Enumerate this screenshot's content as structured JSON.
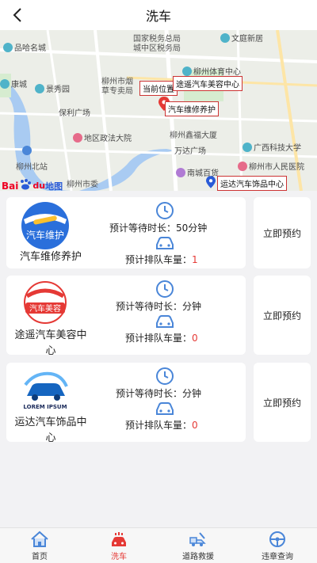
{
  "header": {
    "title": "洗车"
  },
  "map": {
    "labels": {
      "tax_bureau_1": "国家税务总局",
      "tax_bureau_2": "城中区税务局",
      "wenting": "文庭新居",
      "pinming": "品哈名城",
      "gym": "柳州体育中心",
      "kangcheng": "康城",
      "jingxiu": "景秀园",
      "tobacco_1": "柳州市烟",
      "tobacco_2": "草专卖局",
      "baoli": "保利广场",
      "zhengfa": "地区政法大院",
      "xiangfu": "柳州鑫福大厦",
      "wanda": "万达广场",
      "guangxi_tech": "广西科技大学",
      "north_station": "柳州北站",
      "hospital": "柳州市人民医院",
      "nancheng": "南城百货",
      "city_commission": "柳州市委"
    },
    "callouts": {
      "current": "当前位置",
      "shop1": "途遥汽车美容中心",
      "shop2": "汽车维修养护",
      "shop3": "运达汽车饰品中心"
    },
    "brand": {
      "bai": "Bai",
      "du": "du",
      "map": "地图"
    }
  },
  "shops": [
    {
      "name": "汽车维修养护",
      "logo_text": "汽车维护",
      "wait_label": "预计等待时长：",
      "wait_value": "50分钟",
      "queue_label": "预计排队车量：",
      "queue_value": "1",
      "book_label": "立即预约"
    },
    {
      "name": "途遥汽车美容中心",
      "logo_text": "汽车美容",
      "wait_label": "预计等待时长：",
      "wait_value": "分钟",
      "queue_label": "预计排队车量：",
      "queue_value": "0",
      "book_label": "立即预约"
    },
    {
      "name": "运达汽车饰品中心",
      "logo_text": "LOREM IPSUM",
      "wait_label": "预计等待时长：",
      "wait_value": "分钟",
      "queue_label": "预计排队车量：",
      "queue_value": "0",
      "book_label": "立即预约"
    }
  ],
  "tabs": [
    {
      "label": "首页",
      "icon": "home-icon"
    },
    {
      "label": "洗车",
      "icon": "car-wash-icon"
    },
    {
      "label": "道路救援",
      "icon": "tow-truck-icon"
    },
    {
      "label": "违章查询",
      "icon": "steering-wheel-icon"
    }
  ],
  "colors": {
    "accent": "#e53935",
    "icon_blue": "#4a86d8"
  }
}
